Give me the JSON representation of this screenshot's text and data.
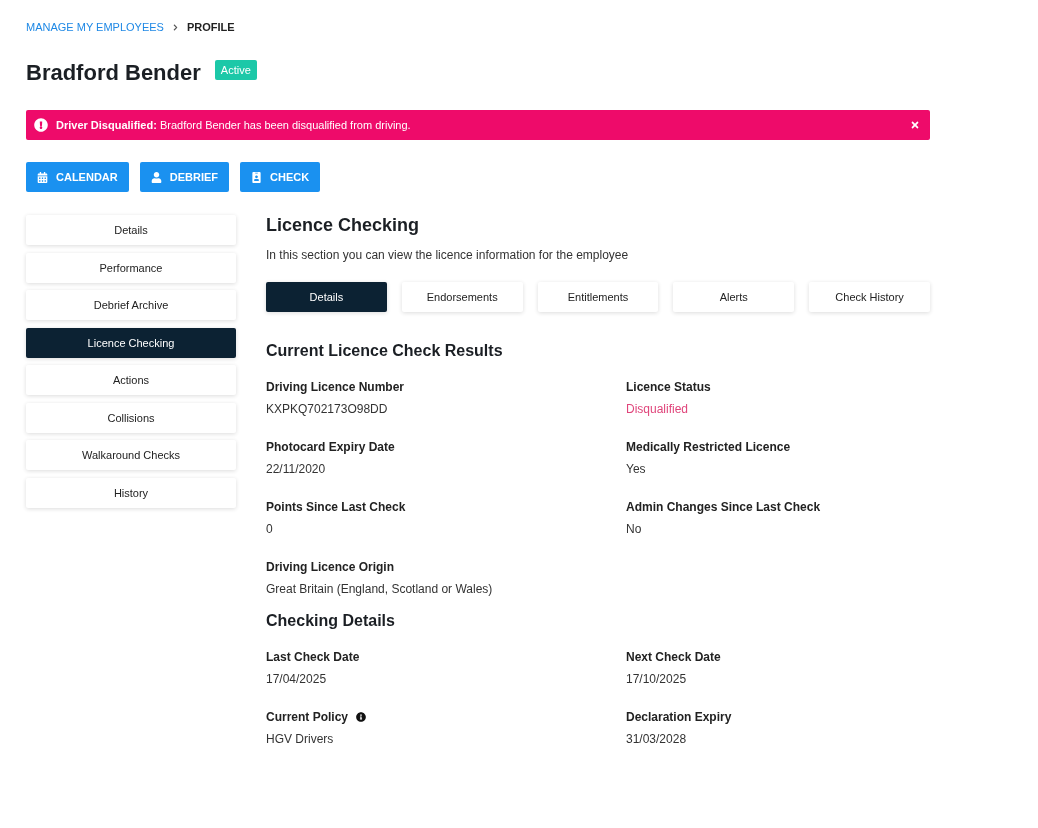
{
  "breadcrumb": [
    {
      "label": "MANAGE MY EMPLOYEES",
      "kind": "link"
    },
    {
      "label": "PROFILE",
      "kind": "current"
    }
  ],
  "profile": {
    "name": "Bradford Bender",
    "status": "Active"
  },
  "alert": {
    "message": "**Driver Disqualified:** Bradford Bender has been disqualified from driving."
  },
  "actions": [
    {
      "label": "CALENDAR",
      "kind": "calendar"
    },
    {
      "label": "DEBRIEF",
      "kind": "person"
    },
    {
      "label": "CHECK",
      "kind": "card"
    }
  ],
  "sidebar": {
    "items": [
      {
        "label": "Details",
        "selected": false
      },
      {
        "label": "Performance",
        "selected": false
      },
      {
        "label": "Debrief Archive",
        "selected": false
      },
      {
        "label": "Licence Checking",
        "selected": true
      },
      {
        "label": "Actions",
        "selected": false
      },
      {
        "label": "Collisions",
        "selected": false
      },
      {
        "label": "Walkaround Checks",
        "selected": false
      },
      {
        "label": "History",
        "selected": false
      }
    ]
  },
  "main": {
    "title": "Licence Checking",
    "description": "In this section you can view the licence information for the employee",
    "tabs": [
      {
        "label": "Details",
        "selected": true
      },
      {
        "label": "Endorsements",
        "selected": false
      },
      {
        "label": "Entitlements",
        "selected": false
      },
      {
        "label": "Alerts",
        "selected": false
      },
      {
        "label": "Check History",
        "selected": false
      }
    ],
    "sections": [
      {
        "title": "Current Licence Check Results",
        "fields": [
          {
            "label": "Driving Licence Number",
            "value": "KXPKQ702173O98DD",
            "kind": "plain",
            "info": false
          },
          {
            "label": "Licence Status",
            "value": "Disqualified",
            "kind": "danger",
            "info": false
          },
          {
            "label": "Photocard Expiry Date",
            "value": "22/11/2020",
            "kind": "plain",
            "info": false
          },
          {
            "label": "Medically Restricted Licence",
            "value": "Yes",
            "kind": "plain",
            "info": false
          },
          {
            "label": "Points Since Last Check",
            "value": "0",
            "kind": "plain",
            "info": false
          },
          {
            "label": "Admin Changes Since Last Check",
            "value": "No",
            "kind": "plain",
            "info": false
          },
          {
            "label": "Driving Licence Origin",
            "value": "Great Britain (England, Scotland or Wales)",
            "kind": "plain",
            "info": false
          }
        ]
      },
      {
        "title": "Checking Details",
        "fields": [
          {
            "label": "Last Check Date",
            "value": "17/04/2025",
            "kind": "plain",
            "info": false
          },
          {
            "label": "Next Check Date",
            "value": "17/10/2025",
            "kind": "plain",
            "info": false
          },
          {
            "label": "Current Policy",
            "value": "HGV Drivers",
            "kind": "plain",
            "info": true
          },
          {
            "label": "Declaration Expiry",
            "value": "31/03/2028",
            "kind": "plain",
            "info": false
          }
        ]
      }
    ]
  }
}
